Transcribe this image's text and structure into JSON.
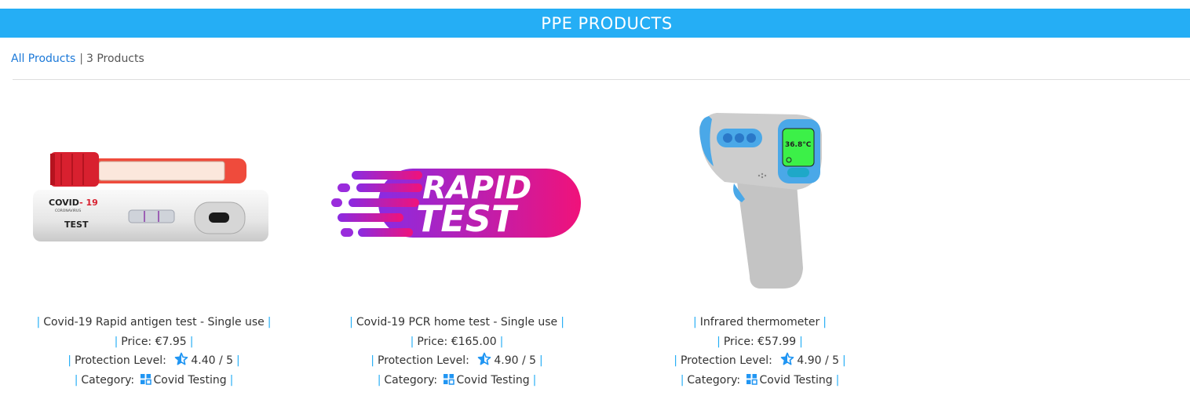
{
  "header": {
    "title": "PPE PRODUCTS"
  },
  "breadcrumb": {
    "all_products": "All Products",
    "separator": "|",
    "count": "3 Products"
  },
  "labels": {
    "bar": "|",
    "price": "Price:",
    "protection": "Protection Level:",
    "category": "Category:"
  },
  "colors": {
    "header_bg": "#25aef5",
    "link": "#1a78d8",
    "accent": "#25aef5"
  },
  "products": [
    {
      "name": "Covid-19 Rapid antigen test - Single use",
      "price": "€7.95",
      "rating": "4.40 / 5",
      "category": "Covid Testing",
      "image_icon": "covid-antigen-test-kit-image"
    },
    {
      "name": "Covid-19 PCR home test - Single use",
      "price": "€165.00",
      "rating": "4.90 / 5",
      "category": "Covid Testing",
      "image_icon": "rapid-test-logo-image",
      "image_text": [
        "RAPID",
        "TEST"
      ]
    },
    {
      "name": "Infrared thermometer",
      "price": "€57.99",
      "rating": "4.90 / 5",
      "category": "Covid Testing",
      "image_icon": "infrared-thermometer-image",
      "image_text": [
        "36.8°C"
      ]
    }
  ],
  "kit_text": {
    "brand_a": "COVID",
    "brand_b": "- 19",
    "sub": "CORONAVIRUS",
    "test": "TEST"
  }
}
